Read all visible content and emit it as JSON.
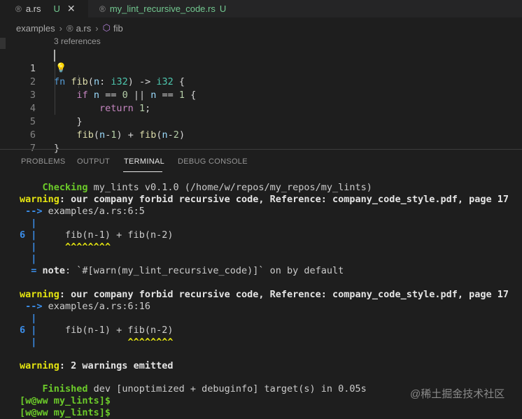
{
  "tabs": [
    {
      "icon": "rust-icon",
      "label": "a.rs",
      "status": "U",
      "close": "✕"
    },
    {
      "icon": "rust-icon",
      "label": "my_lint_recursive_code.rs",
      "status": "U"
    }
  ],
  "breadcrumb": {
    "folder": "examples",
    "file": "a.rs",
    "symbol": "fib"
  },
  "editor": {
    "codelens": "3 references",
    "line_numbers": [
      "1",
      "2",
      "3",
      "4",
      "5",
      "6",
      "7"
    ]
  },
  "panel": {
    "tabs": [
      "PROBLEMS",
      "OUTPUT",
      "TERMINAL",
      "DEBUG CONSOLE"
    ],
    "active_tab": "TERMINAL"
  },
  "terminal": {
    "checking": "Checking",
    "checking_rest": " my_lints v0.1.0 (/home/w/repos/my_repos/my_lints)",
    "warning_word": "warning",
    "warning_msg": ": our company forbid recursive code, Reference: company_code_style.pdf, page 17",
    "arrow": "-->",
    "loc1": " examples/a.rs:6:5",
    "loc2": " examples/a.rs:6:16",
    "pipe": "|",
    "line6": "6 |",
    "code6": "     fib(n-1) + fib(n-2)",
    "carets1": "     ^^^^^^^^",
    "carets2": "                ^^^^^^^^",
    "note_eq": "= ",
    "note_word": "note",
    "note_msg": ": `#[warn(my_lint_recursive_code)]` on by default",
    "summary": ": 2 warnings emitted",
    "finished": "Finished",
    "finished_rest": " dev [unoptimized + debuginfo] target(s) in 0.05s",
    "prompt1": "[w@ww my_lints]$",
    "prompt2": "[w@ww my_lints]$"
  },
  "watermark": "@稀土掘金技术社区",
  "colors": {
    "background": "#1e1e1e",
    "keyword": "#569cd6",
    "function": "#dcdcaa",
    "type": "#4ec9b0",
    "number": "#b5cea8",
    "terminal_green": "#6ccb2a",
    "terminal_yellow": "#e5e510",
    "terminal_blue": "#3b8eea",
    "untracked": "#73c991"
  }
}
